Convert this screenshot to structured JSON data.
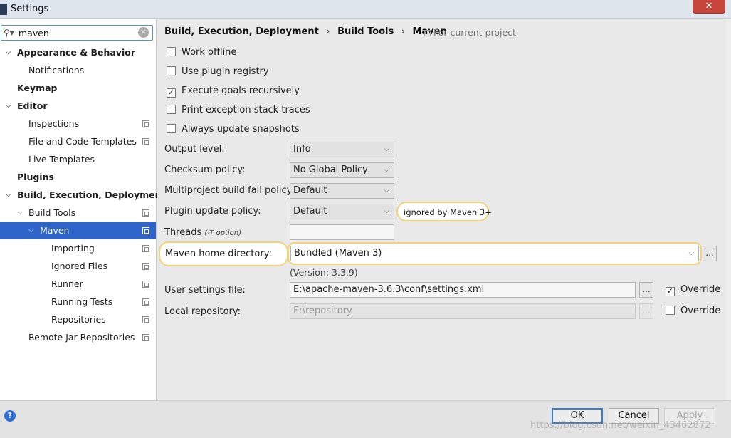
{
  "window": {
    "title": "Settings",
    "close_glyph": "✕"
  },
  "search": {
    "value": "maven",
    "icon": "search-icon",
    "clear_glyph": "✕"
  },
  "tree": [
    {
      "label": "Appearance & Behavior",
      "bold": true,
      "arrow": "⌄"
    },
    {
      "label": "Notifications"
    },
    {
      "label": "Keymap",
      "bold": true
    },
    {
      "label": "Editor",
      "bold": true,
      "arrow": "⌄"
    },
    {
      "label": "Inspections"
    },
    {
      "label": "File and Code Templates"
    },
    {
      "label": "Live Templates"
    },
    {
      "label": "Plugins",
      "bold": true
    },
    {
      "label": "Build, Execution, Deployment",
      "bold": true,
      "arrow": "⌄"
    },
    {
      "label": "Build Tools",
      "arrow": "⌄"
    },
    {
      "label": "Maven",
      "arrow": "⌄",
      "selected": true
    },
    {
      "label": "Importing"
    },
    {
      "label": "Ignored Files"
    },
    {
      "label": "Runner"
    },
    {
      "label": "Running Tests"
    },
    {
      "label": "Repositories"
    },
    {
      "label": "Remote Jar Repositories"
    }
  ],
  "breadcrumb": {
    "items": [
      "Build, Execution, Deployment",
      "Build Tools",
      "Maven"
    ],
    "separator": "›",
    "hint": "For current project"
  },
  "options": {
    "work_offline": {
      "label": "Work offline",
      "checked": false
    },
    "use_plugin_registry": {
      "label": "Use plugin registry",
      "checked": false
    },
    "execute_goals_recursively": {
      "label": "Execute goals recursively",
      "checked": true
    },
    "print_exception_stack_traces": {
      "label": "Print exception stack traces",
      "checked": false
    },
    "always_update_snapshots": {
      "label": "Always update snapshots",
      "checked": false
    }
  },
  "fields": {
    "output_level": {
      "label": "Output level:",
      "value": "Info"
    },
    "checksum_policy": {
      "label": "Checksum policy:",
      "value": "No Global Policy"
    },
    "multiproject_fail_policy": {
      "label": "Multiproject build fail policy:",
      "value": "Default"
    },
    "plugin_update_policy": {
      "label": "Plugin update policy:",
      "value": "Default",
      "note": "ignored by Maven 3+"
    },
    "threads": {
      "label": "Threads",
      "hint": "(-T option)",
      "value": ""
    },
    "maven_home": {
      "label": "Maven home directory:",
      "value": "Bundled (Maven 3)",
      "version": "(Version: 3.3.9)"
    },
    "user_settings": {
      "label": "User settings file:",
      "value": "E:\\apache-maven-3.6.3\\conf\\settings.xml",
      "override_label": "Override",
      "override_checked": true
    },
    "local_repository": {
      "label": "Local repository:",
      "value": "E:\\repository",
      "override_label": "Override",
      "override_checked": false
    }
  },
  "glyphs": {
    "chevron_down": "⌵",
    "ellipsis": "...",
    "check": "✓"
  },
  "buttons": {
    "ok": "OK",
    "cancel": "Cancel",
    "apply": "Apply",
    "help": "?"
  },
  "watermark": "https://blog.csdn.net/weixin_43462872"
}
